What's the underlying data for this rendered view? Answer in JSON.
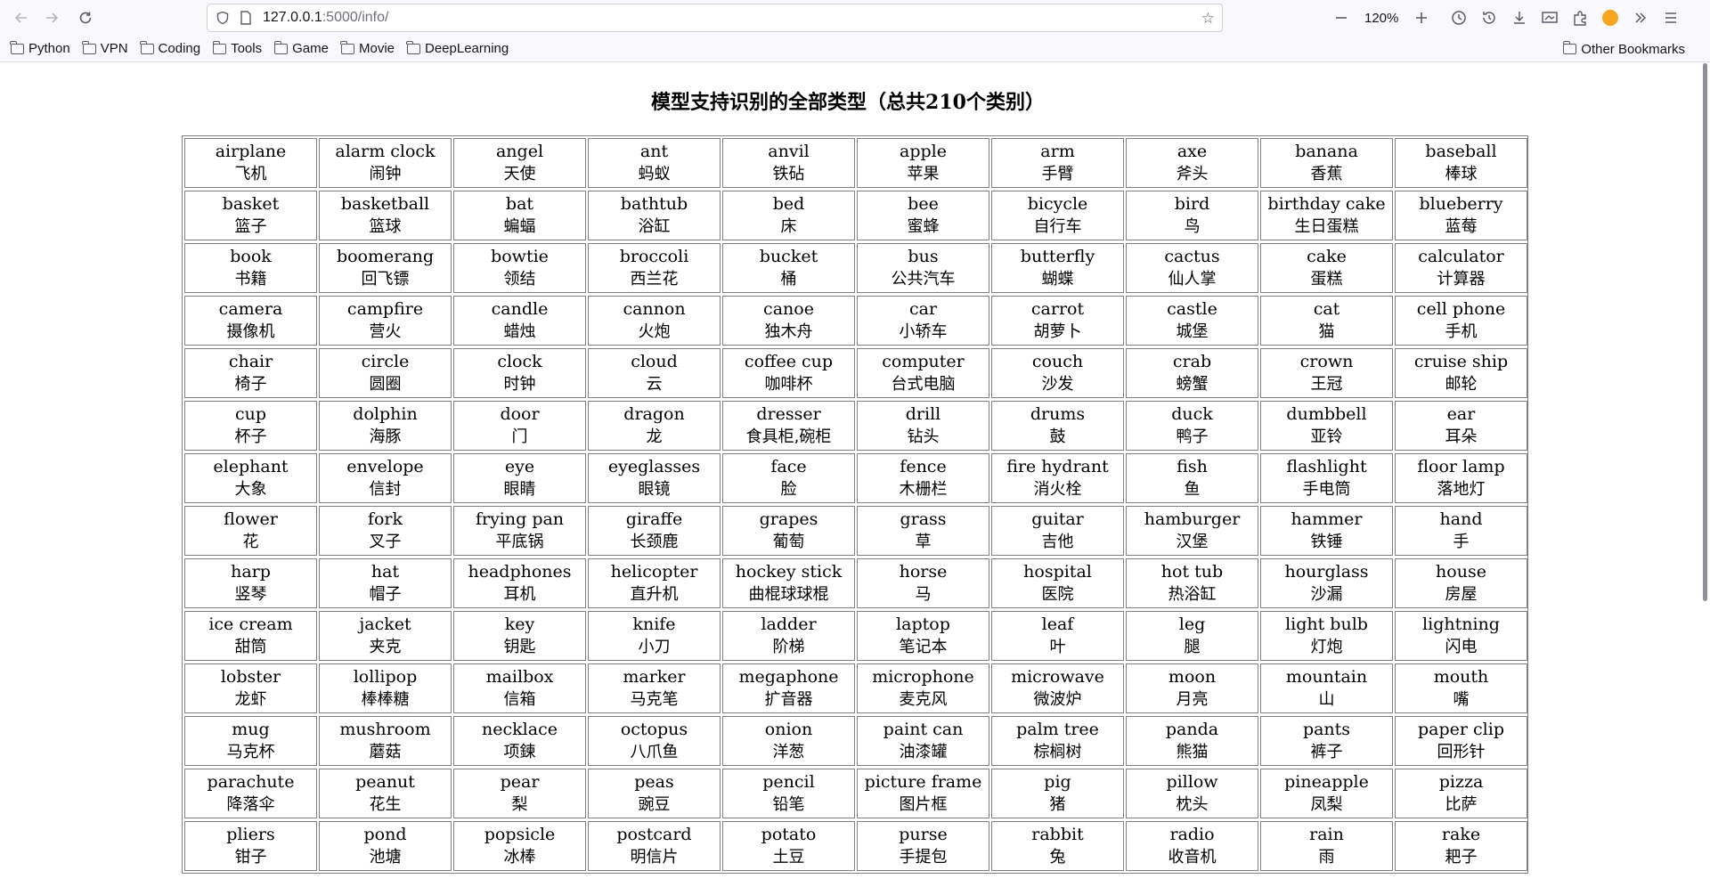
{
  "browser": {
    "url_host": "127.0.0.1",
    "url_rest": ":5000/info/",
    "zoom": "120%",
    "bookmarks": [
      "Python",
      "VPN",
      "Coding",
      "Tools",
      "Game",
      "Movie",
      "DeepLearning"
    ],
    "other_bookmarks": "Other Bookmarks"
  },
  "page": {
    "title": "模型支持识别的全部类型（总共210个类别）",
    "categories": [
      {
        "en": "airplane",
        "zh": "飞机"
      },
      {
        "en": "alarm clock",
        "zh": "闹钟"
      },
      {
        "en": "angel",
        "zh": "天使"
      },
      {
        "en": "ant",
        "zh": "蚂蚁"
      },
      {
        "en": "anvil",
        "zh": "铁砧"
      },
      {
        "en": "apple",
        "zh": "苹果"
      },
      {
        "en": "arm",
        "zh": "手臂"
      },
      {
        "en": "axe",
        "zh": "斧头"
      },
      {
        "en": "banana",
        "zh": "香蕉"
      },
      {
        "en": "baseball",
        "zh": "棒球"
      },
      {
        "en": "basket",
        "zh": "篮子"
      },
      {
        "en": "basketball",
        "zh": "篮球"
      },
      {
        "en": "bat",
        "zh": "蝙蝠"
      },
      {
        "en": "bathtub",
        "zh": "浴缸"
      },
      {
        "en": "bed",
        "zh": "床"
      },
      {
        "en": "bee",
        "zh": "蜜蜂"
      },
      {
        "en": "bicycle",
        "zh": "自行车"
      },
      {
        "en": "bird",
        "zh": "鸟"
      },
      {
        "en": "birthday cake",
        "zh": "生日蛋糕"
      },
      {
        "en": "blueberry",
        "zh": "蓝莓"
      },
      {
        "en": "book",
        "zh": "书籍"
      },
      {
        "en": "boomerang",
        "zh": "回飞镖"
      },
      {
        "en": "bowtie",
        "zh": "领结"
      },
      {
        "en": "broccoli",
        "zh": "西兰花"
      },
      {
        "en": "bucket",
        "zh": "桶"
      },
      {
        "en": "bus",
        "zh": "公共汽车"
      },
      {
        "en": "butterfly",
        "zh": "蝴蝶"
      },
      {
        "en": "cactus",
        "zh": "仙人掌"
      },
      {
        "en": "cake",
        "zh": "蛋糕"
      },
      {
        "en": "calculator",
        "zh": "计算器"
      },
      {
        "en": "camera",
        "zh": "摄像机"
      },
      {
        "en": "campfire",
        "zh": "营火"
      },
      {
        "en": "candle",
        "zh": "蜡烛"
      },
      {
        "en": "cannon",
        "zh": "火炮"
      },
      {
        "en": "canoe",
        "zh": "独木舟"
      },
      {
        "en": "car",
        "zh": "小轿车"
      },
      {
        "en": "carrot",
        "zh": "胡萝卜"
      },
      {
        "en": "castle",
        "zh": "城堡"
      },
      {
        "en": "cat",
        "zh": "猫"
      },
      {
        "en": "cell phone",
        "zh": "手机"
      },
      {
        "en": "chair",
        "zh": "椅子"
      },
      {
        "en": "circle",
        "zh": "圆圈"
      },
      {
        "en": "clock",
        "zh": "时钟"
      },
      {
        "en": "cloud",
        "zh": "云"
      },
      {
        "en": "coffee cup",
        "zh": "咖啡杯"
      },
      {
        "en": "computer",
        "zh": "台式电脑"
      },
      {
        "en": "couch",
        "zh": "沙发"
      },
      {
        "en": "crab",
        "zh": "螃蟹"
      },
      {
        "en": "crown",
        "zh": "王冠"
      },
      {
        "en": "cruise ship",
        "zh": "邮轮"
      },
      {
        "en": "cup",
        "zh": "杯子"
      },
      {
        "en": "dolphin",
        "zh": "海豚"
      },
      {
        "en": "door",
        "zh": "门"
      },
      {
        "en": "dragon",
        "zh": "龙"
      },
      {
        "en": "dresser",
        "zh": "食具柜,碗柜"
      },
      {
        "en": "drill",
        "zh": "钻头"
      },
      {
        "en": "drums",
        "zh": "鼓"
      },
      {
        "en": "duck",
        "zh": "鸭子"
      },
      {
        "en": "dumbbell",
        "zh": "亚铃"
      },
      {
        "en": "ear",
        "zh": "耳朵"
      },
      {
        "en": "elephant",
        "zh": "大象"
      },
      {
        "en": "envelope",
        "zh": "信封"
      },
      {
        "en": "eye",
        "zh": "眼睛"
      },
      {
        "en": "eyeglasses",
        "zh": "眼镜"
      },
      {
        "en": "face",
        "zh": "脸"
      },
      {
        "en": "fence",
        "zh": "木栅栏"
      },
      {
        "en": "fire hydrant",
        "zh": "消火栓"
      },
      {
        "en": "fish",
        "zh": "鱼"
      },
      {
        "en": "flashlight",
        "zh": "手电筒"
      },
      {
        "en": "floor lamp",
        "zh": "落地灯"
      },
      {
        "en": "flower",
        "zh": "花"
      },
      {
        "en": "fork",
        "zh": "叉子"
      },
      {
        "en": "frying pan",
        "zh": "平底锅"
      },
      {
        "en": "giraffe",
        "zh": "长颈鹿"
      },
      {
        "en": "grapes",
        "zh": "葡萄"
      },
      {
        "en": "grass",
        "zh": "草"
      },
      {
        "en": "guitar",
        "zh": "吉他"
      },
      {
        "en": "hamburger",
        "zh": "汉堡"
      },
      {
        "en": "hammer",
        "zh": "铁锤"
      },
      {
        "en": "hand",
        "zh": "手"
      },
      {
        "en": "harp",
        "zh": "竖琴"
      },
      {
        "en": "hat",
        "zh": "帽子"
      },
      {
        "en": "headphones",
        "zh": "耳机"
      },
      {
        "en": "helicopter",
        "zh": "直升机"
      },
      {
        "en": "hockey stick",
        "zh": "曲棍球球棍"
      },
      {
        "en": "horse",
        "zh": "马"
      },
      {
        "en": "hospital",
        "zh": "医院"
      },
      {
        "en": "hot tub",
        "zh": "热浴缸"
      },
      {
        "en": "hourglass",
        "zh": "沙漏"
      },
      {
        "en": "house",
        "zh": "房屋"
      },
      {
        "en": "ice cream",
        "zh": "甜筒"
      },
      {
        "en": "jacket",
        "zh": "夹克"
      },
      {
        "en": "key",
        "zh": "钥匙"
      },
      {
        "en": "knife",
        "zh": "小刀"
      },
      {
        "en": "ladder",
        "zh": "阶梯"
      },
      {
        "en": "laptop",
        "zh": "笔记本"
      },
      {
        "en": "leaf",
        "zh": "叶"
      },
      {
        "en": "leg",
        "zh": "腿"
      },
      {
        "en": "light bulb",
        "zh": "灯炮"
      },
      {
        "en": "lightning",
        "zh": "闪电"
      },
      {
        "en": "lobster",
        "zh": "龙虾"
      },
      {
        "en": "lollipop",
        "zh": "棒棒糖"
      },
      {
        "en": "mailbox",
        "zh": "信箱"
      },
      {
        "en": "marker",
        "zh": "马克笔"
      },
      {
        "en": "megaphone",
        "zh": "扩音器"
      },
      {
        "en": "microphone",
        "zh": "麦克风"
      },
      {
        "en": "microwave",
        "zh": "微波炉"
      },
      {
        "en": "moon",
        "zh": "月亮"
      },
      {
        "en": "mountain",
        "zh": "山"
      },
      {
        "en": "mouth",
        "zh": "嘴"
      },
      {
        "en": "mug",
        "zh": "马克杯"
      },
      {
        "en": "mushroom",
        "zh": "蘑菇"
      },
      {
        "en": "necklace",
        "zh": "项鍊"
      },
      {
        "en": "octopus",
        "zh": "八爪鱼"
      },
      {
        "en": "onion",
        "zh": "洋葱"
      },
      {
        "en": "paint can",
        "zh": "油漆罐"
      },
      {
        "en": "palm tree",
        "zh": "棕榈树"
      },
      {
        "en": "panda",
        "zh": "熊猫"
      },
      {
        "en": "pants",
        "zh": "裤子"
      },
      {
        "en": "paper clip",
        "zh": "回形针"
      },
      {
        "en": "parachute",
        "zh": "降落伞"
      },
      {
        "en": "peanut",
        "zh": "花生"
      },
      {
        "en": "pear",
        "zh": "梨"
      },
      {
        "en": "peas",
        "zh": "豌豆"
      },
      {
        "en": "pencil",
        "zh": "铅笔"
      },
      {
        "en": "picture frame",
        "zh": "图片框"
      },
      {
        "en": "pig",
        "zh": "猪"
      },
      {
        "en": "pillow",
        "zh": "枕头"
      },
      {
        "en": "pineapple",
        "zh": "凤梨"
      },
      {
        "en": "pizza",
        "zh": "比萨"
      },
      {
        "en": "pliers",
        "zh": "钳子"
      },
      {
        "en": "pond",
        "zh": "池塘"
      },
      {
        "en": "popsicle",
        "zh": "冰棒"
      },
      {
        "en": "postcard",
        "zh": "明信片"
      },
      {
        "en": "potato",
        "zh": "土豆"
      },
      {
        "en": "purse",
        "zh": "手提包"
      },
      {
        "en": "rabbit",
        "zh": "兔"
      },
      {
        "en": "radio",
        "zh": "收音机"
      },
      {
        "en": "rain",
        "zh": "雨"
      },
      {
        "en": "rake",
        "zh": "耙子"
      }
    ]
  }
}
